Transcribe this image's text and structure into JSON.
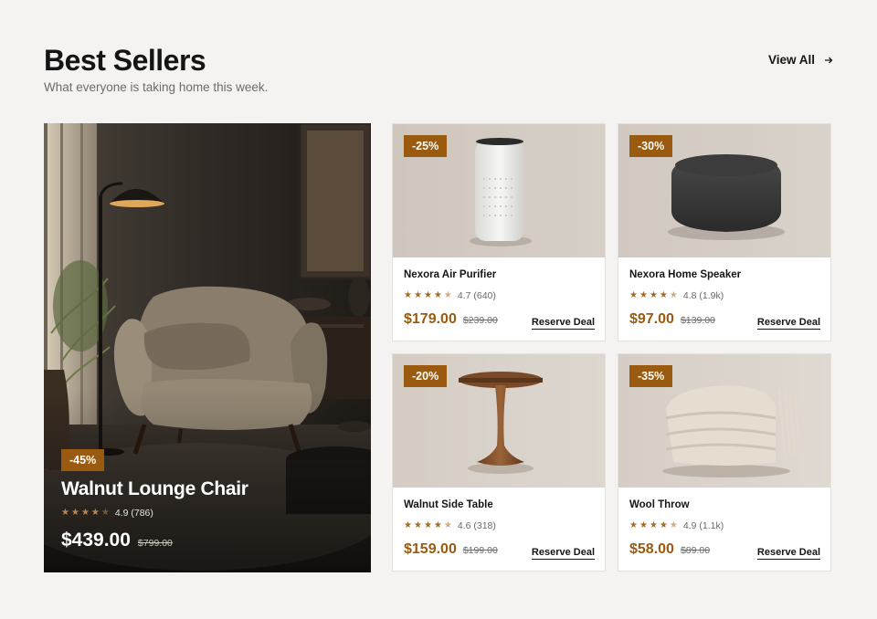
{
  "header": {
    "title": "Best Sellers",
    "subtitle": "What everyone is taking home this week.",
    "view_all_label": "View All"
  },
  "featured": {
    "badge": "-45%",
    "name": "Walnut Lounge Chair",
    "rating": "4.9",
    "reviews": "(786)",
    "stars": 4.5,
    "price": "$439.00",
    "old_price": "$799.00"
  },
  "products": [
    {
      "badge": "-25%",
      "name": "Nexora Air Purifier",
      "rating": "4.7",
      "reviews": "(640)",
      "stars": 4.5,
      "price": "$179.00",
      "old_price": "$239.00",
      "action": "Reserve Deal"
    },
    {
      "badge": "-30%",
      "name": "Nexora Home Speaker",
      "rating": "4.8",
      "reviews": "(1.9k)",
      "stars": 4.5,
      "price": "$97.00",
      "old_price": "$139.00",
      "action": "Reserve Deal"
    },
    {
      "badge": "-20%",
      "name": "Walnut Side Table",
      "rating": "4.6",
      "reviews": "(318)",
      "stars": 4.5,
      "price": "$159.00",
      "old_price": "$199.00",
      "action": "Reserve Deal"
    },
    {
      "badge": "-35%",
      "name": "Wool Throw",
      "rating": "4.9",
      "reviews": "(1.1k)",
      "stars": 4.5,
      "price": "$58.00",
      "old_price": "$89.00",
      "action": "Reserve Deal"
    }
  ],
  "colors": {
    "accent": "#9a5a10",
    "star": "#a26a25",
    "background": "#f4f3f1"
  }
}
